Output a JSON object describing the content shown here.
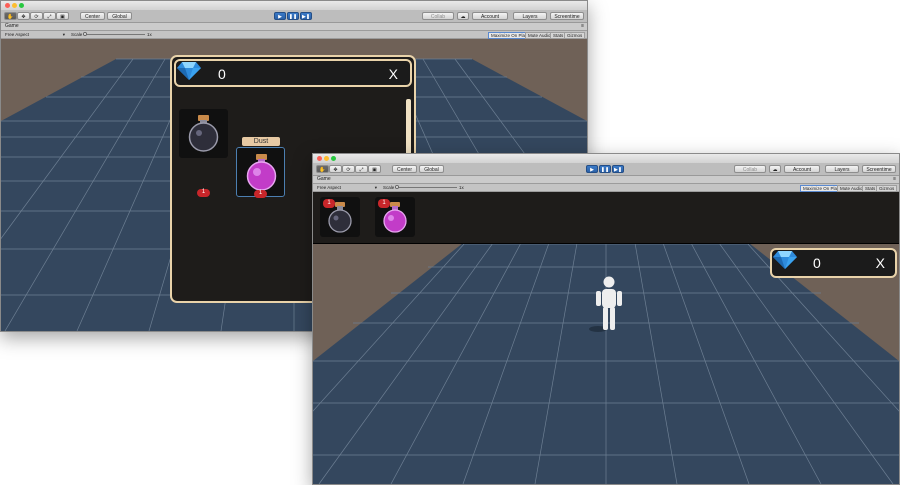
{
  "editor": {
    "toolbar": {
      "pivot_label": "Center",
      "space_label": "Global",
      "collab_label": "Collab",
      "account_label": "Account",
      "layers_label": "Layers",
      "layout_label": "Screentime"
    },
    "tab": {
      "label": "Game",
      "menu_label": "≡"
    },
    "game_bar": {
      "aspect_label": "Free Aspect",
      "scale_label": "Scale",
      "scale_value": "1x",
      "maximize_label": "Maximize On Play",
      "mute_label": "Mute Audio",
      "stats_label": "Stats",
      "gizmos_label": "Gizmos"
    }
  },
  "inventory": {
    "gem_count": "0",
    "close_label": "X",
    "tooltip": "Dust",
    "items": [
      {
        "name": "Dark Potion",
        "count": "1",
        "color": "#6a6a7c"
      },
      {
        "name": "Dust",
        "count": "1",
        "color": "#c23cc8"
      }
    ]
  },
  "hud": {
    "gem_count": "0",
    "close_label": "X",
    "items": [
      {
        "name": "Dark Potion",
        "count": "1",
        "color": "#6a6a7c"
      },
      {
        "name": "Dust",
        "count": "1",
        "color": "#c23cc8"
      }
    ]
  },
  "colors": {
    "panel_border": "#e9d3aa",
    "panel_bg": "#1e1c1a",
    "badge_red": "#c8262a",
    "ground": "#34475e",
    "grid_line": "#6d7f93",
    "skybox": "#6f6157",
    "play_blue": "#2d62a8"
  },
  "icons": [
    "gem-icon",
    "hand-tool-icon",
    "move-tool-icon",
    "rotate-tool-icon",
    "scale-tool-icon",
    "rect-tool-icon",
    "play-icon",
    "pause-icon",
    "step-icon",
    "cloud-icon",
    "close-icon",
    "potion-icon",
    "character-figure"
  ]
}
